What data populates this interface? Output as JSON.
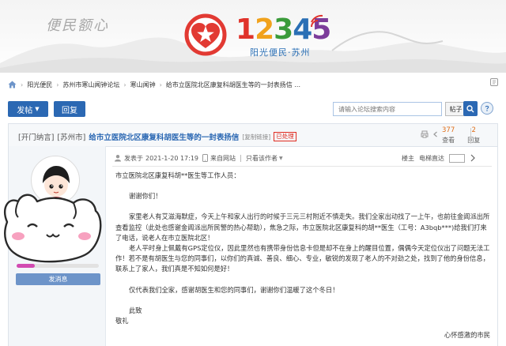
{
  "header": {
    "calligraphy": "便民额心",
    "logo_digits": [
      "1",
      "2",
      "3",
      "4",
      "5"
    ],
    "logo_digit_colors": [
      "#e0332b",
      "#f1a21c",
      "#3a9b3a",
      "#2a6fb5",
      "#7c3c9a"
    ],
    "logo_subtitle": "阳光便民·苏州"
  },
  "breadcrumb": {
    "items": [
      "阳光便民",
      "苏州市寒山闻钟论坛",
      "寒山闻钟",
      "给市立医院北区康复科胡医生等的一封表扬信 ..."
    ]
  },
  "toolbar": {
    "post_label": "发帖",
    "reply_label": "回复",
    "search_placeholder": "请输入论坛搜索内容",
    "search_scope": "帖子"
  },
  "thread": {
    "category": "[开门纳言]",
    "region": "[苏州市]",
    "title": "给市立医院北区康复科胡医生等的一封表扬信",
    "copy_link": "[复制链接]",
    "badge": "已处理",
    "views": "377",
    "views_label": "查看",
    "replies": "2",
    "replies_label": "回复"
  },
  "sidebar": {
    "progress": 0.22,
    "message_label": "发消息"
  },
  "post": {
    "posted_prefix": "发表于",
    "posted_time": "2021-1-20 17:19",
    "device": "来自网站",
    "author_only": "只看该作者",
    "floor_label": "楼主",
    "jump_label": "电梯直达",
    "greeting": "市立医院北区康复科胡**医生等工作人员：",
    "thanks": "谢谢你们！",
    "paragraph1": "家里老人有艾滋海默症，今天上午和家人出行的时候于三元三村附近不慎走失。我们全家出动找了一上午，也前往金阊派出所查看监控（此处也感谢金阊派出所民警的热心帮助），焦急之际，市立医院北区康复科的胡**医生（工号：A3bqb***)给我们打来了电话，说老人在市立医院北区！",
    "paragraph2": "老人平时身上佩戴有GPS定位仪，因此里然也有携带身份信息卡但是却不在身上的醒目位置，偶偶今天定位仪出了问题无法工作！若不是有胡医生与您的同事们，以你们的真诚、善良、细心、专业，敏锐的发现了老人的不对劲之处，找到了他的身份信息，联系上了家人，我们真是不知如何是好！",
    "closing": "仅代表我们全家，感谢胡医生和您的同事们，谢谢你们温暖了这个冬日！",
    "salute1": "此致",
    "salute2": "敬礼",
    "signature": "心怀感激的市民"
  }
}
